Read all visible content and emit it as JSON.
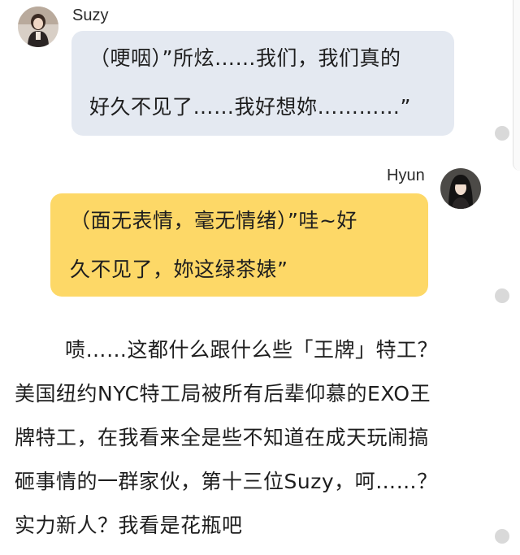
{
  "messages": [
    {
      "sender": "Suzy",
      "lines": [
        "（哽咽）”所炫……我们，我们真的",
        "好久不见了……我好想妳…………”"
      ],
      "bubble_color": "#e4e9f1",
      "avatar_icon": "avatar-suzy-icon"
    },
    {
      "sender": "Hyun",
      "lines": [
        "（面无表情，毫无情绪）”哇~好",
        "久不见了，妳这绿茶婊”"
      ],
      "bubble_color": "#fdd867",
      "avatar_icon": "avatar-hyun-icon"
    }
  ],
  "narration": {
    "lines": [
      "啧……这都什么跟什么些「王牌」特工？",
      "美国纽约NYC特工局被所有后辈仰慕的EXO王",
      "牌特工，在我看来全是些不知道在成天玩闹搞",
      "砸事情的一群家伙，第十三位Suzy，呵……？",
      "实力新人？我看是花瓶吧"
    ]
  }
}
